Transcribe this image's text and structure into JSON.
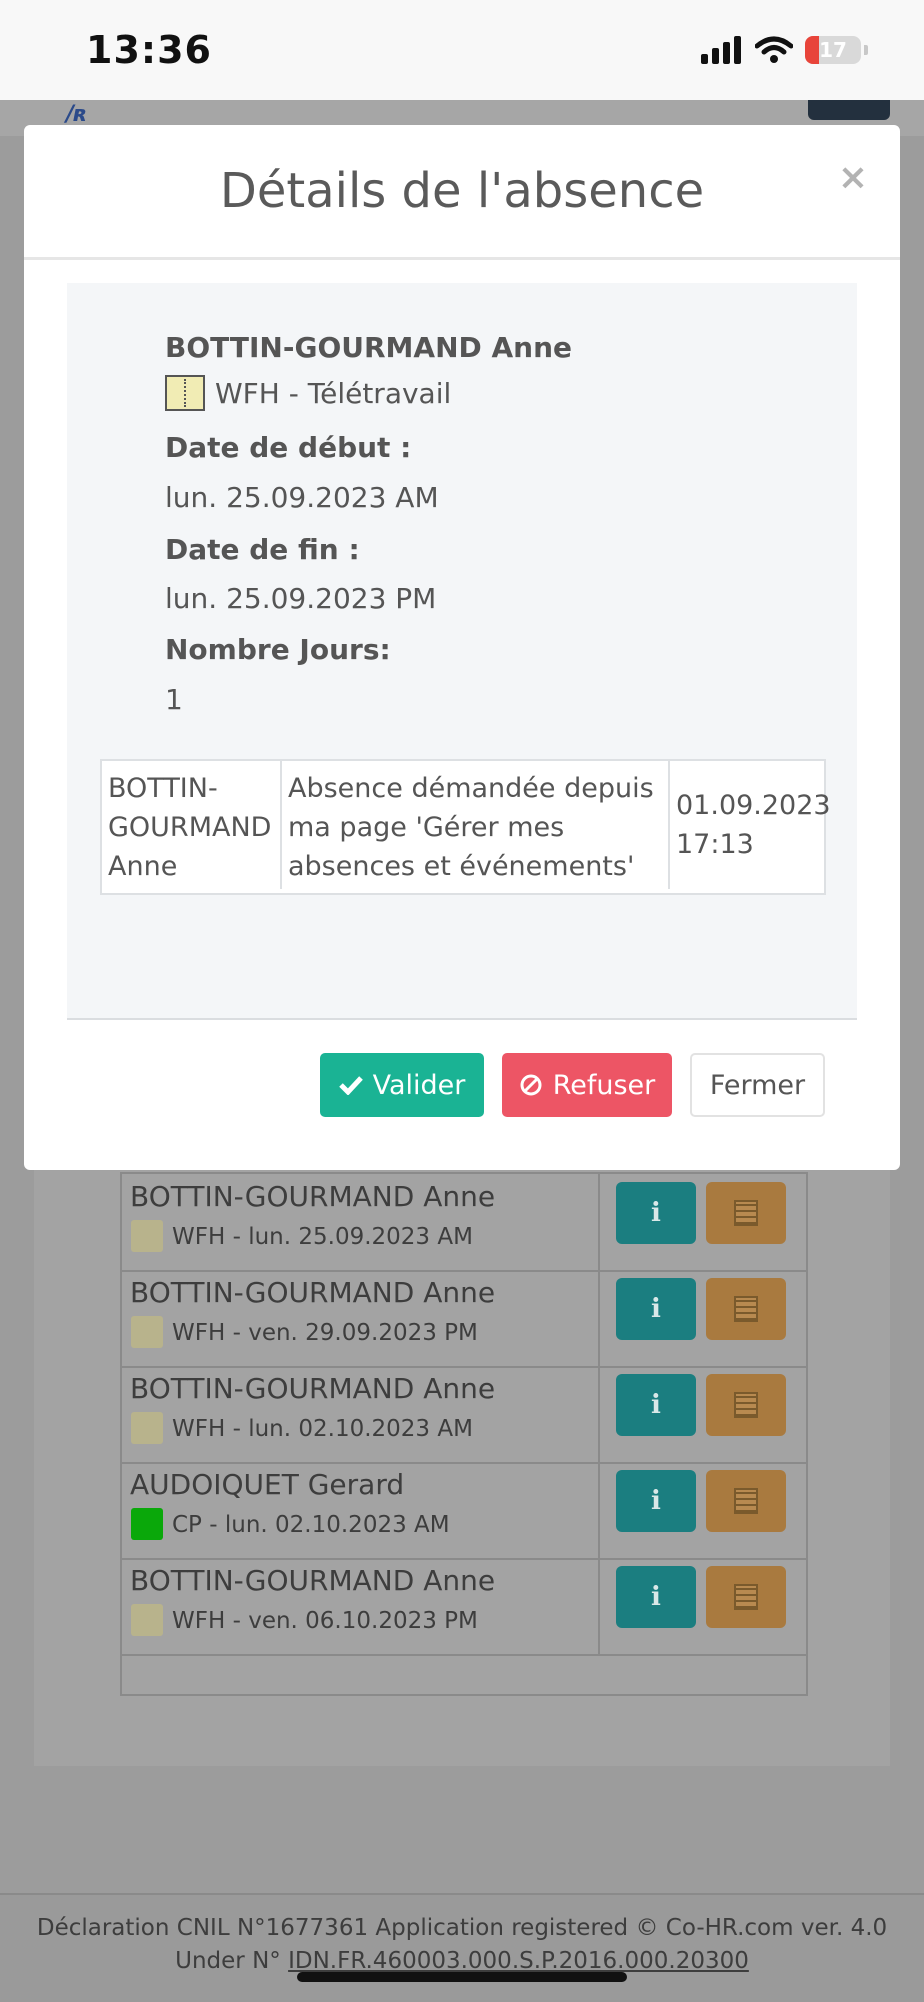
{
  "status_bar": {
    "time": "13:36",
    "battery": "17"
  },
  "modal": {
    "title": "Détails de l'absence",
    "close_symbol": "×",
    "employee": "BOTTIN-GOURMAND Anne",
    "absence_type": "WFH - Télétravail",
    "absence_type_color": "#f1ecb4",
    "start_label": "Date de début :",
    "start_value": "lun. 25.09.2023 AM",
    "end_label": "Date de fin :",
    "end_value": "lun. 25.09.2023 PM",
    "days_label": "Nombre Jours:",
    "days_value": "1",
    "history": {
      "name": "BOTTIN-GOURMAND Anne",
      "comment": "Absence démandée depuis ma page 'Gérer mes absences et événements'",
      "date": "01.09.2023 17:13"
    },
    "buttons": {
      "validate": "Valider",
      "refuse": "Refuser",
      "close": "Fermer"
    }
  },
  "background_list": [
    {
      "name": "BOTTIN-GOURMAND Anne",
      "type": "WFH",
      "date": "- lun. 25.09.2023 AM",
      "color": "#b8b38c"
    },
    {
      "name": "BOTTIN-GOURMAND Anne",
      "type": "WFH",
      "date": "- ven. 29.09.2023 PM",
      "color": "#b8b38c"
    },
    {
      "name": "BOTTIN-GOURMAND Anne",
      "type": "WFH",
      "date": "- lun. 02.10.2023 AM",
      "color": "#b8b38c"
    },
    {
      "name": "AUDOIQUET Gerard",
      "type": "CP",
      "date": "- lun. 02.10.2023 AM",
      "color": "#0aa80a"
    },
    {
      "name": "BOTTIN-GOURMAND Anne",
      "type": "WFH",
      "date": "- ven. 06.10.2023 PM",
      "color": "#b8b38c"
    }
  ],
  "footer": {
    "line1": "Déclaration CNIL N°1677361    Application registered    © Co-HR.com ver. 4.0",
    "line2_prefix": "Under N° ",
    "line2_id": "IDN.FR.460003.000.S.P.2016.000.20300"
  }
}
